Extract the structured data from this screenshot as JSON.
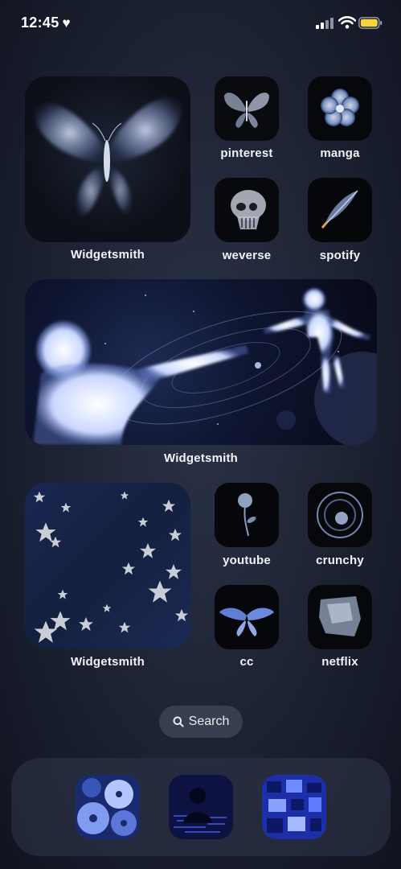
{
  "status_bar": {
    "time": "12:45",
    "heart": "♥",
    "battery_color": "#f6d23b"
  },
  "widgets": {
    "top": {
      "label": "Widgetsmith",
      "image": "butterfly"
    },
    "middle": {
      "label": "Widgetsmith",
      "image": "two-figures-in-space"
    },
    "bottom": {
      "label": "Widgetsmith",
      "image": "stars-fabric"
    }
  },
  "apps": [
    {
      "label": "pinterest",
      "icon": "butterfly-icon"
    },
    {
      "label": "manga",
      "icon": "flower-icon"
    },
    {
      "label": "weverse",
      "icon": "skull-icon"
    },
    {
      "label": "spotify",
      "icon": "feather-icon"
    },
    {
      "label": "youtube",
      "icon": "rose-icon"
    },
    {
      "label": "crunchy",
      "icon": "spiral-icon"
    },
    {
      "label": "cc",
      "icon": "moth-icon"
    },
    {
      "label": "netflix",
      "icon": "plastic-bag-icon"
    }
  ],
  "search": {
    "label": "Search"
  },
  "dock": [
    {
      "icon": "cds-icon"
    },
    {
      "icon": "silhouette-code-icon"
    },
    {
      "icon": "screens-icon"
    }
  ]
}
